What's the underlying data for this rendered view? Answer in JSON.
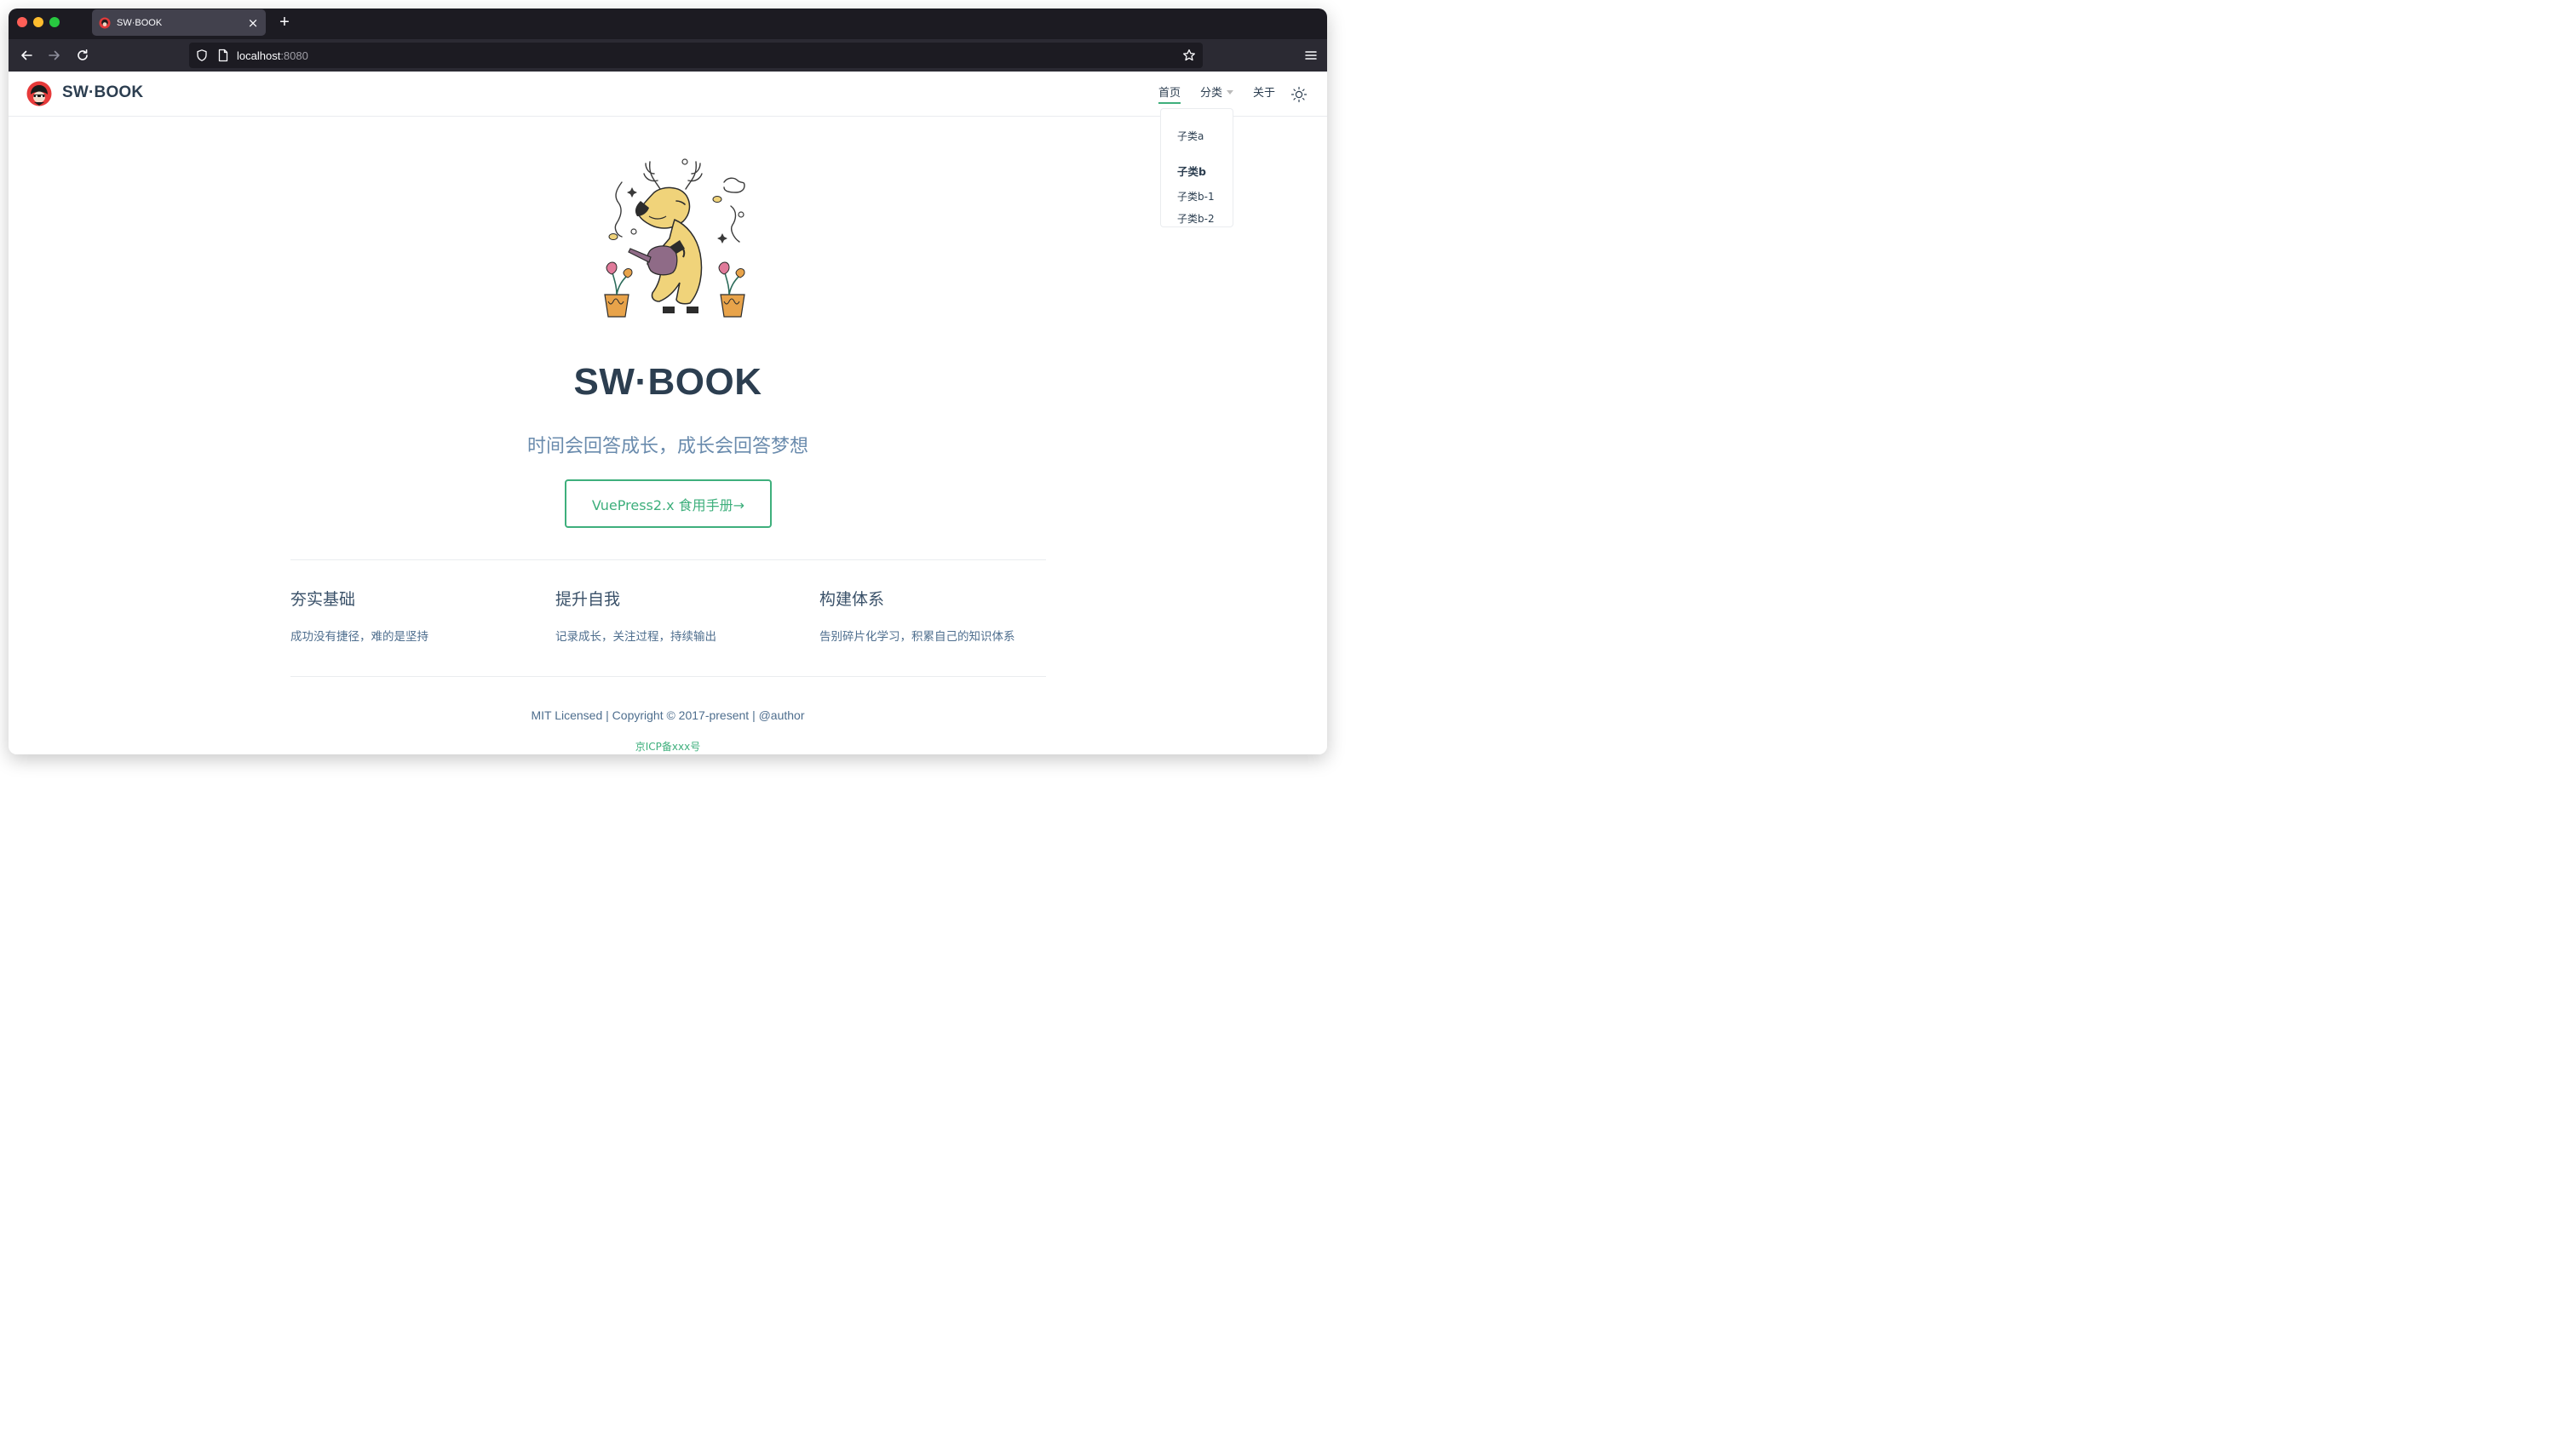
{
  "browser": {
    "tab_title": "SW·BOOK",
    "tab_close": "×",
    "new_tab": "+",
    "url_host": "localhost",
    "url_port": ":8080"
  },
  "site": {
    "name": "SW·BOOK",
    "nav": {
      "home": "首页",
      "category": "分类",
      "about": "关于"
    },
    "dropdown": {
      "item_a": "子类a",
      "group_b": "子类b",
      "item_b1": "子类b-1",
      "item_b2": "子类b-2"
    },
    "hero": {
      "title": "SW·BOOK",
      "description": "时间会回答成长，成长会回答梦想",
      "action": "VuePress2.x 食用手册→"
    },
    "features": [
      {
        "title": "夯实基础",
        "details": "成功没有捷径，难的是坚持"
      },
      {
        "title": "提升自我",
        "details": "记录成长，关注过程，持续输出"
      },
      {
        "title": "构建体系",
        "details": "告别碎片化学习，积累自己的知识体系"
      }
    ],
    "footer": {
      "copyright": "MIT Licensed | Copyright © 2017-present | @author",
      "icp": "京ICP备xxx号"
    }
  },
  "colors": {
    "accent": "#3eaf7c",
    "text": "#2c3e50",
    "description": "#6a8bad"
  }
}
